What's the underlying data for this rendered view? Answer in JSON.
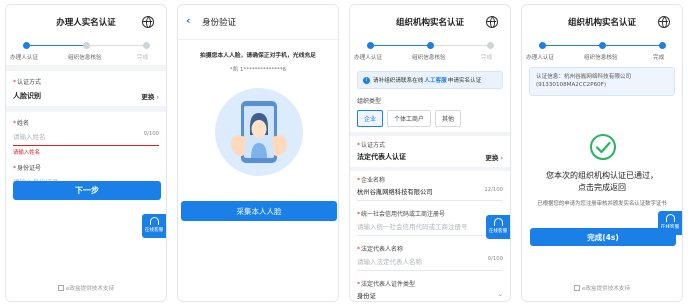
{
  "colors": {
    "primary": "#1a7fe6",
    "error": "#e02020",
    "success": "#28b463"
  },
  "panel1": {
    "title": "办理人实名认证",
    "steps": [
      "办理人认证",
      "组织信息核验",
      "完成"
    ],
    "auth_method": {
      "label": "认证方式",
      "value": "人脸识别",
      "action": "更换"
    },
    "name": {
      "label": "姓名",
      "placeholder": "请输入姓名",
      "counter": "0/100",
      "error": "请输入姓名"
    },
    "id_number": {
      "label": "身份证号",
      "placeholder": "请输入身份证号"
    },
    "next_button": "下一步",
    "online_service": "在线客服",
    "support": "e政盒提供技术支持"
  },
  "panel2": {
    "title": "身份验证",
    "instruction": "拍摄您本人人脸，请确保正对手机，光线充足",
    "masked_info": "*凯 1**************6",
    "capture_button": "采集本人人脸"
  },
  "panel3": {
    "title": "组织机构实名认证",
    "steps": [
      "办理人认证",
      "组织信息核验",
      "完成"
    ],
    "notice_prefix": "请补组织请联系在线",
    "notice_link": "人工客服",
    "notice_suffix": "申请实名认证",
    "org_type": {
      "label": "组织类型",
      "options": [
        "企业",
        "个体工商户",
        "其他"
      ]
    },
    "auth_method": {
      "label": "认证方式",
      "value": "法定代表人认证",
      "action": "更换"
    },
    "company_name": {
      "label": "企业名称",
      "value": "杭州谷胤网络科技有限公司",
      "counter": "12/100"
    },
    "credit_code": {
      "label": "统一社会信用代码或工商注册号",
      "placeholder": "请输入统一社会信用代码或工商注册号"
    },
    "legal_rep_name": {
      "label": "法定代表人名称",
      "placeholder": "请输入法定代表人名称",
      "counter": "0/100"
    },
    "legal_rep_id_type": {
      "label": "法定代表人证件类型",
      "value": "身份证"
    },
    "online_service": "在线客服"
  },
  "panel4": {
    "title": "组织机构实名认证",
    "steps": [
      "办理人认证",
      "组织信息核验",
      "完成"
    ],
    "org_info_label": "认证信息：杭州谷胤网络科技有限公司",
    "org_info_code": "(91330108MA2CC2P60F)",
    "success_line1": "您本次的组织机构认证已通过，",
    "success_line2": "点击完成返回",
    "sub_text": "已根据您的申请为您注册审核并颁发实名认证数字证书",
    "done_button": "完成(4s)",
    "online_service": "在线客服",
    "support": "e政盒提供技术支持"
  }
}
